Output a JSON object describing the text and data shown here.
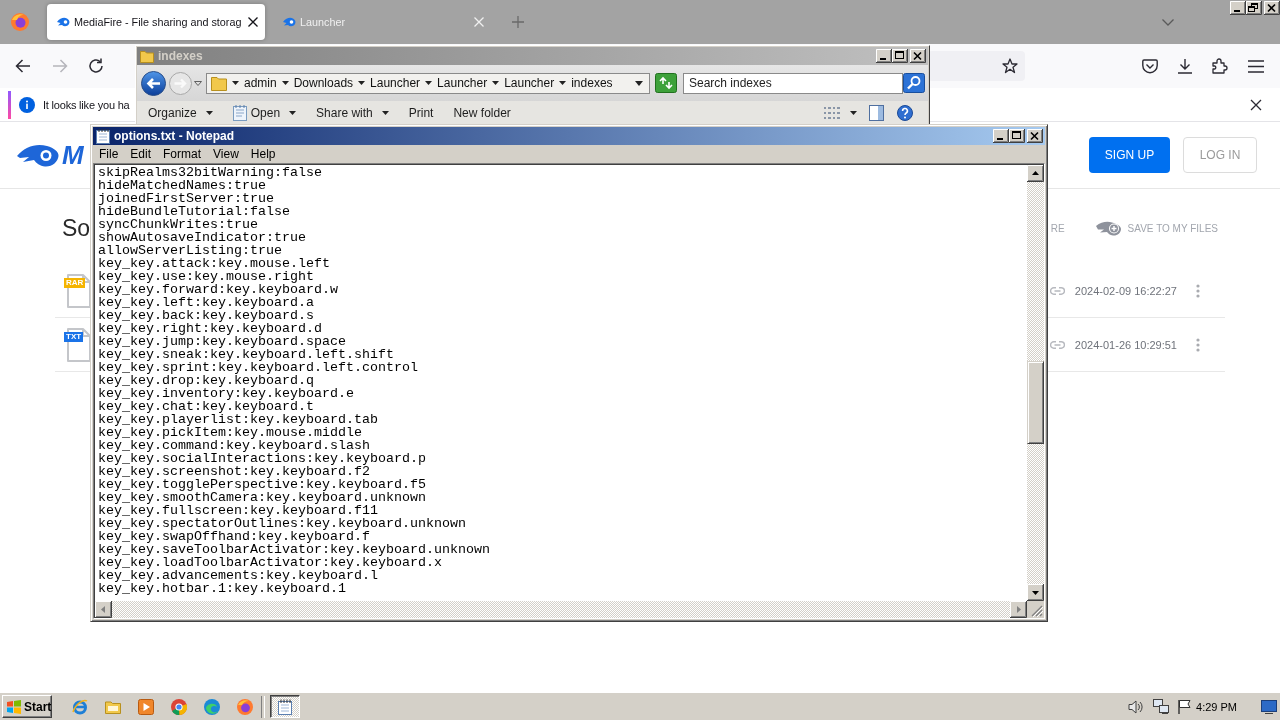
{
  "browser": {
    "tabs": [
      {
        "label": "MediaFire - File sharing and storag",
        "selected": true
      },
      {
        "label": "Launcher",
        "selected": false
      }
    ],
    "notification": {
      "text": "It looks like you ha"
    },
    "page": {
      "logo_text": "M",
      "heading": "So",
      "header_buttons": [
        {
          "label": "SIGN UP",
          "kind": "primary"
        },
        {
          "label": "LOG IN",
          "kind": "secondary"
        }
      ],
      "actions": [
        {
          "label": "RE",
          "kind": "text"
        },
        {
          "label": "SAVE TO MY FILES",
          "kind": "save"
        }
      ],
      "files": [
        {
          "type": "RAR",
          "color": "#f5b400",
          "date": "2024-02-09 16:22:27"
        },
        {
          "type": "TXT",
          "color": "#1a73e8",
          "date": "2024-01-26 10:29:51"
        }
      ]
    }
  },
  "explorer": {
    "title": "indexes",
    "breadcrumbs": [
      "admin",
      "Downloads",
      "Launcher",
      "Launcher",
      "Launcher",
      "indexes"
    ],
    "search": {
      "placeholder": "Search indexes"
    },
    "toolbar": [
      {
        "label": "Organize",
        "kind": "menu"
      },
      {
        "label": "Open",
        "kind": "split"
      },
      {
        "label": "Share with",
        "kind": "menu"
      },
      {
        "label": "Print",
        "kind": "button"
      },
      {
        "label": "New folder",
        "kind": "button"
      }
    ]
  },
  "notepad": {
    "title": "options.txt - Notepad",
    "menu": [
      "File",
      "Edit",
      "Format",
      "View",
      "Help"
    ],
    "lines": [
      "skipRealms32bitWarning:false",
      "hideMatchedNames:true",
      "joinedFirstServer:true",
      "hideBundleTutorial:false",
      "syncChunkWrites:true",
      "showAutosaveIndicator:true",
      "allowServerListing:true",
      "key_key.attack:key.mouse.left",
      "key_key.use:key.mouse.right",
      "key_key.forward:key.keyboard.w",
      "key_key.left:key.keyboard.a",
      "key_key.back:key.keyboard.s",
      "key_key.right:key.keyboard.d",
      "key_key.jump:key.keyboard.space",
      "key_key.sneak:key.keyboard.left.shift",
      "key_key.sprint:key.keyboard.left.control",
      "key_key.drop:key.keyboard.q",
      "key_key.inventory:key.keyboard.e",
      "key_key.chat:key.keyboard.t",
      "key_key.playerlist:key.keyboard.tab",
      "key_key.pickItem:key.mouse.middle",
      "key_key.command:key.keyboard.slash",
      "key_key.socialInteractions:key.keyboard.p",
      "key_key.screenshot:key.keyboard.f2",
      "key_key.togglePerspective:key.keyboard.f5",
      "key_key.smoothCamera:key.keyboard.unknown",
      "key_key.fullscreen:key.keyboard.f11",
      "key_key.spectatorOutlines:key.keyboard.unknown",
      "key_key.swapOffhand:key.keyboard.f",
      "key_key.saveToolbarActivator:key.keyboard.unknown",
      "key_key.loadToolbarActivator:key.keyboard.x",
      "key_key.advancements:key.keyboard.l",
      "key_key.hotbar.1:key.keyboard.1"
    ]
  },
  "taskbar": {
    "start": "Start",
    "tasks": [
      {
        "selected": true
      }
    ],
    "clock": "4:29 PM"
  }
}
